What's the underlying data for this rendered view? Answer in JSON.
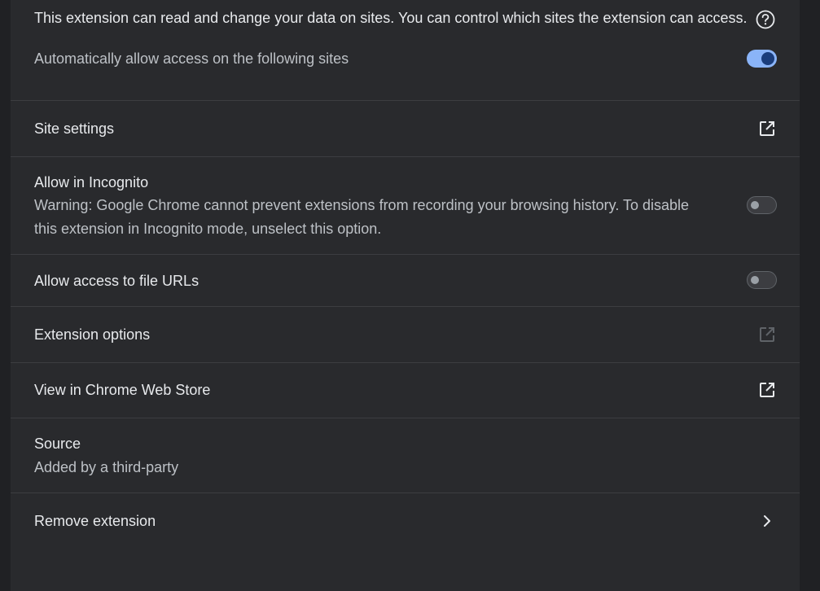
{
  "permissions": {
    "description": "This extension can read and change your data on sites. You can control which sites the extension can access.",
    "auto_allow_label": "Automatically allow access on the following sites",
    "auto_allow_enabled": true
  },
  "site_settings": {
    "label": "Site settings"
  },
  "incognito": {
    "label": "Allow in Incognito",
    "warning_line1": "Warning: Google Chrome cannot prevent extensions from recording your browsing history. To disable",
    "warning_line2": "this extension in Incognito mode, unselect this option.",
    "enabled": false
  },
  "file_urls": {
    "label": "Allow access to file URLs",
    "enabled": false
  },
  "extension_options": {
    "label": "Extension options",
    "disabled": true
  },
  "web_store": {
    "label": "View in Chrome Web Store"
  },
  "source": {
    "label": "Source",
    "value": "Added by a third-party"
  },
  "remove": {
    "label": "Remove extension"
  },
  "colors": {
    "background": "#202124",
    "card": "#292a2d",
    "primary_text": "#e8eaed",
    "secondary_text": "#bdc1c6",
    "accent": "#8ab4f8",
    "divider": "#3c3d41"
  }
}
